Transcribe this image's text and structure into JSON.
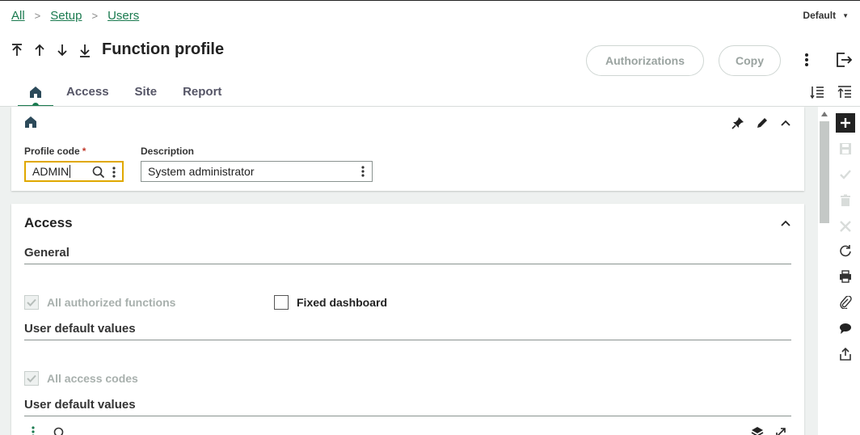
{
  "breadcrumb": [
    {
      "label": "All"
    },
    {
      "label": "Setup"
    },
    {
      "label": "Users"
    }
  ],
  "breadcrumb_separator": ">",
  "profile_selector": {
    "value": "Default"
  },
  "page": {
    "title": "Function profile"
  },
  "actions": {
    "authorizations_label": "Authorizations",
    "copy_label": "Copy"
  },
  "tabs": [
    {
      "label": "Access"
    },
    {
      "label": "Site"
    },
    {
      "label": "Report"
    }
  ],
  "header_block": {
    "profile_code": {
      "label": "Profile code",
      "required_marker": "*",
      "value": "ADMIN"
    },
    "description": {
      "label": "Description",
      "value": "System administrator"
    }
  },
  "access_section": {
    "title": "Access",
    "general": {
      "title": "General",
      "all_authorized_functions": {
        "label": "All authorized functions",
        "checked": true,
        "disabled": true
      },
      "fixed_dashboard": {
        "label": "Fixed dashboard",
        "checked": false
      }
    },
    "user_default_values_1": {
      "title": "User default values",
      "all_access_codes": {
        "label": "All access codes",
        "checked": true,
        "disabled": true
      }
    },
    "user_default_values_2": {
      "title": "User default values"
    }
  },
  "colors": {
    "accent": "#1a7a4f",
    "focus": "#e0a800",
    "required": "#c0392b",
    "content_bg": "#eef1f0"
  },
  "icons": [
    "first-record-icon",
    "previous-record-icon",
    "next-record-icon",
    "last-record-icon",
    "more-vertical-icon",
    "exit-icon",
    "home-icon",
    "pin-icon",
    "edit-icon",
    "chevron-up-icon",
    "search-icon",
    "add-icon",
    "save-icon",
    "validate-icon",
    "delete-icon",
    "cancel-icon",
    "refresh-icon",
    "print-icon",
    "attachment-icon",
    "comment-icon",
    "export-icon",
    "layers-icon",
    "expand-icon"
  ]
}
